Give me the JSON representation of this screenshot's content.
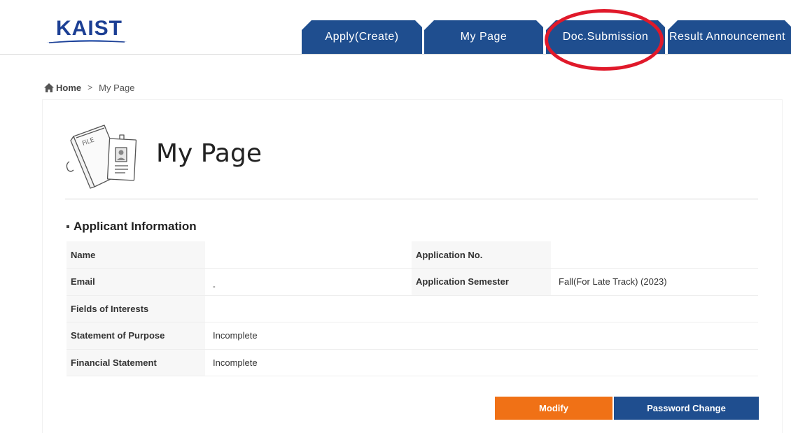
{
  "header": {
    "logo_text": "KAIST",
    "tabs": [
      {
        "label": "Apply(Create)"
      },
      {
        "label": "My Page"
      },
      {
        "label": "Doc.Submission"
      },
      {
        "label": "Result Announcement"
      }
    ]
  },
  "breadcrumb": {
    "home": "Home",
    "separator": ">",
    "current": "My Page"
  },
  "page": {
    "title": "My Page",
    "section_title": "Applicant Information"
  },
  "applicant": {
    "name_label": "Name",
    "name_value": "",
    "application_no_label": "Application No.",
    "application_no_value": "",
    "email_label": "Email",
    "email_value": "-",
    "semester_label": "Application Semester",
    "semester_value": "Fall(For Late Track) (2023)",
    "fields_label": "Fields of Interests",
    "fields_value": "",
    "sop_label": "Statement of Purpose",
    "sop_value": "Incomplete",
    "financial_label": "Financial Statement",
    "financial_value": "Incomplete"
  },
  "actions": {
    "modify": "Modify",
    "password_change": "Password Change"
  },
  "colors": {
    "brand_blue": "#1f4e8f",
    "accent_orange": "#f07116",
    "annotation_red": "#e0192a",
    "logo_blue": "#1c3f94"
  }
}
